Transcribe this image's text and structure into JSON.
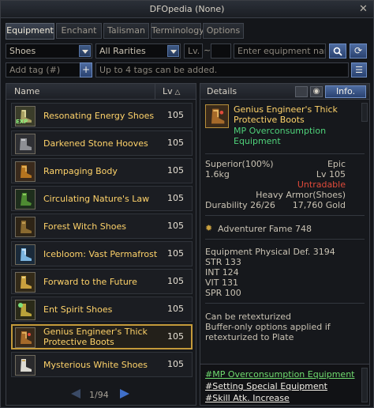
{
  "window": {
    "title": "DFOpedia (None)"
  },
  "tabs": [
    {
      "label": "Equipment",
      "active": true
    },
    {
      "label": "Enchant",
      "active": false
    },
    {
      "label": "Talisman",
      "active": false
    },
    {
      "label": "Terminology",
      "active": false
    },
    {
      "label": "Options",
      "active": false
    }
  ],
  "filters": {
    "category": "Shoes",
    "rarity": "All Rarities",
    "level_label": "Lv.",
    "level_sep": "~",
    "search_placeholder": "Enter equipment name",
    "tag_placeholder": "Add tag (#)",
    "tag_hint": "Up to 4 tags can be added."
  },
  "list": {
    "col_name": "Name",
    "col_level": "Lv",
    "items": [
      {
        "name": "Resonating Energy Shoes",
        "level": "105",
        "badge": "EXP"
      },
      {
        "name": "Darkened Stone Hooves",
        "level": "105"
      },
      {
        "name": "Rampaging Body",
        "level": "105"
      },
      {
        "name": "Circulating Nature's Law",
        "level": "105"
      },
      {
        "name": "Forest Witch Shoes",
        "level": "105"
      },
      {
        "name": "Icebloom: Vast Permafrost",
        "level": "105"
      },
      {
        "name": "Forward to the Future",
        "level": "105"
      },
      {
        "name": "Ent Spirit Shoes",
        "level": "105"
      },
      {
        "name": "Genius Engineer's Thick Protective Boots",
        "level": "105",
        "selected": true
      },
      {
        "name": "Mysterious White Shoes",
        "level": "105"
      }
    ],
    "pager": "1/94"
  },
  "details": {
    "header": "Details",
    "info_button": "Info.",
    "name": "Genius Engineer's Thick Protective Boots",
    "type": "MP Overconsumption Equipment",
    "grade": "Superior(100%)",
    "rarity": "Epic",
    "weight": "1.6kg",
    "level": "Lv 105",
    "untradable": "Untradable",
    "armor": "Heavy Armor(Shoes)",
    "durability": "Durability 26/26",
    "price": "17,760 Gold",
    "fame": "Adventurer Fame 748",
    "stats": [
      "Equipment Physical Def. 3194",
      "STR 133",
      "INT 124",
      "VIT 131",
      "SPR 100"
    ],
    "notes": [
      "Can be retexturized",
      "Buffer-only options applied if",
      "retexturized to Plate"
    ],
    "tags": [
      "#MP Overconsumption Equipment",
      "#Setting Special Equipment",
      "#Skill Atk. Increase"
    ]
  },
  "colors": {
    "item_name": "#ffd36a",
    "equip_type": "#4fd27a",
    "untradable": "#e04a3a",
    "selected_border": "#c49a3a"
  }
}
